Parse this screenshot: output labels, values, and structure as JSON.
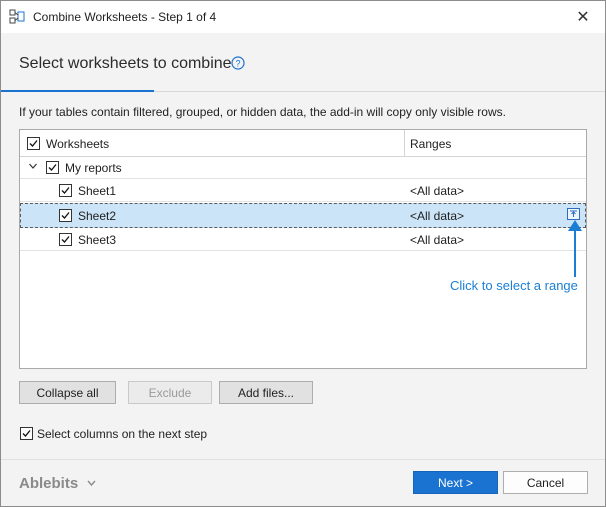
{
  "window": {
    "title": "Combine Worksheets - Step 1 of 4",
    "close_glyph": "✕"
  },
  "step": {
    "title": "Select worksheets to combine"
  },
  "info": "If your tables contain filtered, grouped, or hidden data, the add-in will copy only visible rows.",
  "grid": {
    "header": {
      "worksheets": "Worksheets",
      "ranges": "Ranges",
      "checked": true
    },
    "group": {
      "label": "My reports",
      "checked": true,
      "expanded": true
    },
    "rows": [
      {
        "label": "Sheet1",
        "range": "<All data>",
        "checked": true,
        "selected": false
      },
      {
        "label": "Sheet2",
        "range": "<All data>",
        "checked": true,
        "selected": true
      },
      {
        "label": "Sheet3",
        "range": "<All data>",
        "checked": true,
        "selected": false
      }
    ]
  },
  "hint": "Click to select a range",
  "buttons": {
    "collapse_all": "Collapse all",
    "exclude": "Exclude",
    "add_files": "Add files...",
    "next": "Next >",
    "cancel": "Cancel"
  },
  "options": {
    "select_columns_label": "Select columns on the next step",
    "select_columns_checked": true
  },
  "brand": {
    "name": "Ablebits"
  },
  "colors": {
    "accent": "#1a73d0",
    "hint": "#1a7fd4",
    "selection": "#cce4f7"
  },
  "icons": {
    "app": "combine-sheets-icon",
    "help": "help-circle-icon",
    "range_picker": "range-select-icon",
    "expand": "chevron-down-icon"
  }
}
